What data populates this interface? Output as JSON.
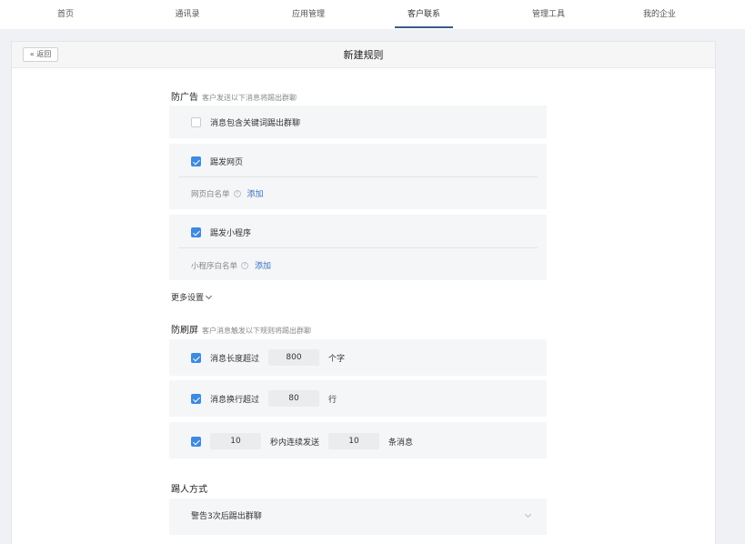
{
  "nav": {
    "items": [
      {
        "label": "首页"
      },
      {
        "label": "通讯录"
      },
      {
        "label": "应用管理"
      },
      {
        "label": "客户联系"
      },
      {
        "label": "管理工具"
      },
      {
        "label": "我的企业"
      }
    ],
    "active_index": 3
  },
  "header": {
    "back_label": "返回",
    "title": "新建规则"
  },
  "anti_ad": {
    "title": "防广告",
    "desc": "客户发送以下消息将踢出群聊",
    "keyword": {
      "label": "消息包含关键词踢出群聊",
      "checked": false
    },
    "webpage": {
      "label": "踢发网页",
      "checked": true,
      "whitelist_label": "网页白名单",
      "add_label": "添加"
    },
    "miniprogram": {
      "label": "踢发小程序",
      "checked": true,
      "whitelist_label": "小程序白名单",
      "add_label": "添加"
    }
  },
  "more_settings": "更多设置",
  "anti_spam": {
    "title": "防刷屏",
    "desc": "客户消息触发以下规则将踢出群聊",
    "length": {
      "prefix": "消息长度超过",
      "value": "800",
      "unit": "个字",
      "checked": true
    },
    "lines": {
      "prefix": "消息换行超过",
      "value": "80",
      "unit": "行",
      "checked": true
    },
    "burst": {
      "seconds": "10",
      "middle": "秒内连续发送",
      "count": "10",
      "unit": "条消息",
      "checked": true
    }
  },
  "kick": {
    "title": "踢人方式",
    "selected": "警告3次后踢出群聊"
  },
  "colors": {
    "accent": "#3d8ae0",
    "link": "#3a6fc4",
    "nav_active": "#3c5a8c"
  }
}
